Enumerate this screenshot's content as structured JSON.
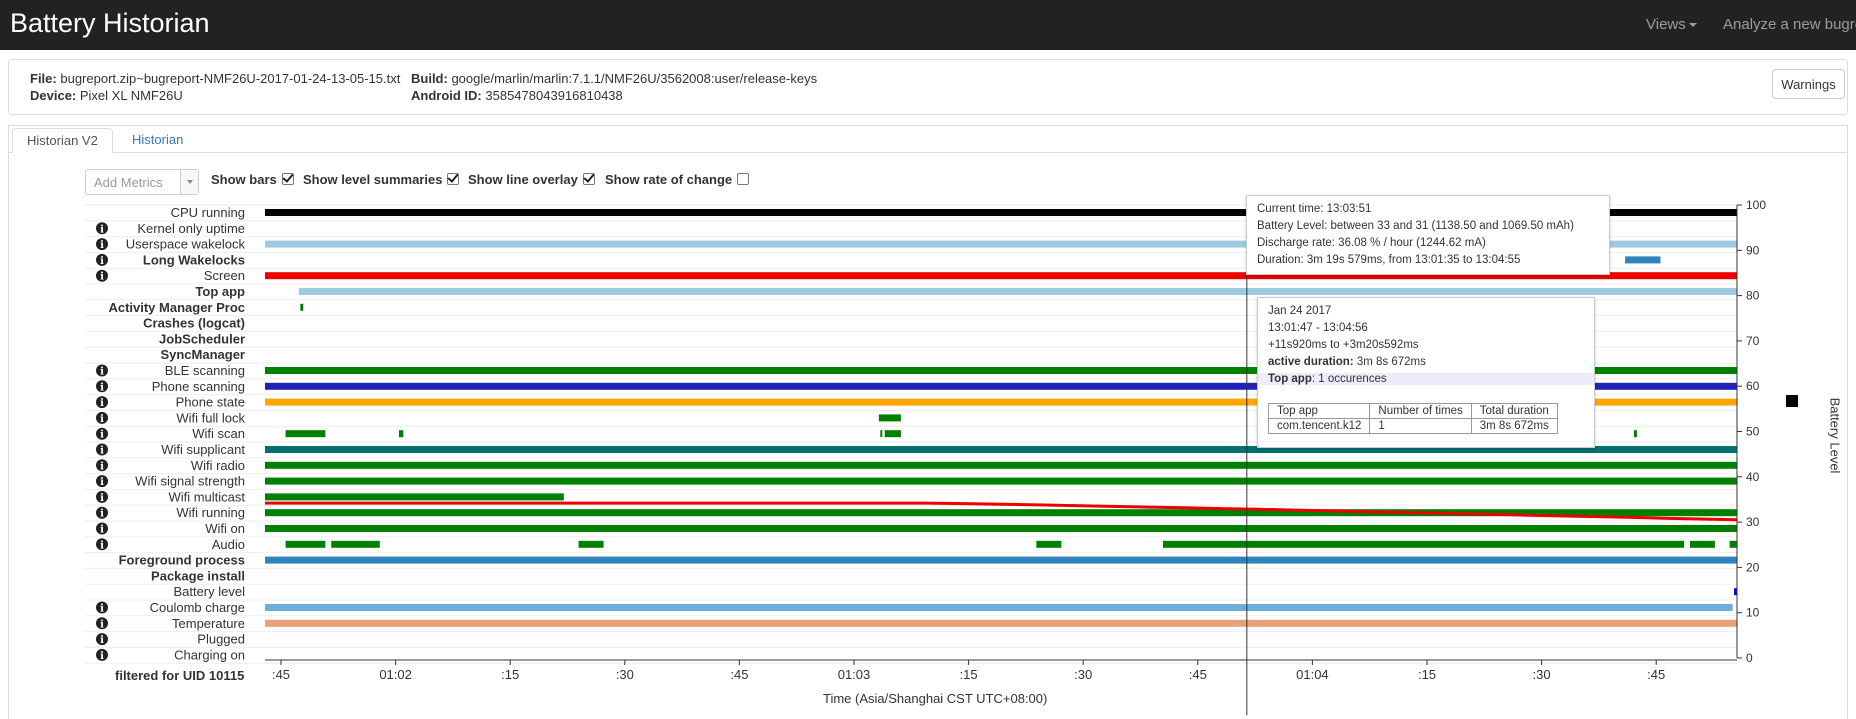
{
  "app": {
    "title": "Battery Historian",
    "nav": {
      "views": "Views",
      "analyze": "Analyze a new bugre"
    }
  },
  "file_info": {
    "file_label": "File:",
    "file_value": "bugreport.zip~bugreport-NMF26U-2017-01-24-13-05-15.txt",
    "device_label": "Device:",
    "device_value": "Pixel XL NMF26U",
    "build_label": "Build:",
    "build_value": "google/marlin/marlin:7.1.1/NMF26U/3562008:user/release-keys",
    "android_id_label": "Android ID:",
    "android_id_value": "3585478043916810438",
    "warnings_button": "Warnings"
  },
  "tabs": [
    {
      "label": "Historian V2",
      "active": true
    },
    {
      "label": "Historian",
      "active": false
    }
  ],
  "controls": {
    "add_metrics_placeholder": "Add Metrics",
    "show_bars": {
      "label": "Show bars",
      "checked": true
    },
    "show_level_summaries": {
      "label": "Show level summaries",
      "checked": true
    },
    "show_line_overlay": {
      "label": "Show line overlay",
      "checked": true
    },
    "show_rate_of_change": {
      "label": "Show rate of change",
      "checked": false
    }
  },
  "chart_data": {
    "type": "timeline",
    "x_label": "Time (Asia/Shanghai CST UTC+08:00)",
    "x_ticks": [
      ":45",
      "01:02",
      ":15",
      ":30",
      ":45",
      "01:03",
      ":15",
      ":30",
      ":45",
      "01:04",
      ":15",
      ":30",
      ":45"
    ],
    "y_right": {
      "label": "Battery Level",
      "ticks": [
        0,
        10,
        20,
        30,
        40,
        50,
        60,
        70,
        80,
        90,
        100
      ],
      "ylim": [
        0,
        100
      ]
    },
    "filter_label": "filtered for UID 10115",
    "battery_level_line": {
      "color": "#ee0000",
      "start": 34.2,
      "end": 30.5
    },
    "cursor_fraction": 0.667,
    "rows": [
      {
        "name": "CPU running",
        "bold": false,
        "info": false,
        "color": "#000000",
        "bars": [
          [
            0,
            1
          ]
        ]
      },
      {
        "name": "Kernel only uptime",
        "bold": false,
        "info": true,
        "color": "#000000",
        "bars": []
      },
      {
        "name": "Userspace wakelock",
        "bold": false,
        "info": true,
        "color": "#9ecae1",
        "bars": [
          [
            0,
            1
          ]
        ]
      },
      {
        "name": "Long Wakelocks",
        "bold": true,
        "info": true,
        "color": "#3182bd",
        "bars": [
          [
            0.924,
            0.948
          ]
        ]
      },
      {
        "name": "Screen",
        "bold": false,
        "info": true,
        "color": "#ee0000",
        "bars": [
          [
            0,
            1
          ]
        ]
      },
      {
        "name": "Top app",
        "bold": true,
        "info": false,
        "color": "#9ecae1",
        "bars": [
          [
            0.023,
            1
          ]
        ]
      },
      {
        "name": "Activity Manager Proc",
        "bold": true,
        "info": false,
        "color": "#008000",
        "bars": [
          [
            0.024,
            0.026
          ]
        ]
      },
      {
        "name": "Crashes (logcat)",
        "bold": true,
        "info": false,
        "color": "#000000",
        "bars": []
      },
      {
        "name": "JobScheduler",
        "bold": true,
        "info": false,
        "color": "#000000",
        "bars": []
      },
      {
        "name": "SyncManager",
        "bold": true,
        "info": false,
        "color": "#000000",
        "bars": []
      },
      {
        "name": "BLE scanning",
        "bold": false,
        "info": true,
        "color": "#008000",
        "bars": [
          [
            0,
            1
          ]
        ]
      },
      {
        "name": "Phone scanning",
        "bold": false,
        "info": true,
        "color": "#2222bb",
        "bars": [
          [
            0,
            1
          ]
        ]
      },
      {
        "name": "Phone state",
        "bold": false,
        "info": true,
        "color": "#ffa500",
        "bars": [
          [
            0,
            1
          ]
        ]
      },
      {
        "name": "Wifi full lock",
        "bold": false,
        "info": true,
        "color": "#008000",
        "bars": [
          [
            0.417,
            0.432
          ]
        ]
      },
      {
        "name": "Wifi scan",
        "bold": false,
        "info": true,
        "color": "#008000",
        "bars": [
          [
            0.014,
            0.041
          ],
          [
            0.091,
            0.094
          ],
          [
            0.418,
            0.419
          ],
          [
            0.421,
            0.432
          ],
          [
            0.93,
            0.932
          ]
        ]
      },
      {
        "name": "Wifi supplicant",
        "bold": false,
        "info": true,
        "color": "#007070",
        "bars": [
          [
            0,
            1
          ]
        ]
      },
      {
        "name": "Wifi radio",
        "bold": false,
        "info": true,
        "color": "#008000",
        "bars": [
          [
            0,
            1
          ]
        ]
      },
      {
        "name": "Wifi signal strength",
        "bold": false,
        "info": true,
        "color": "#008000",
        "bars": [
          [
            0,
            1
          ]
        ]
      },
      {
        "name": "Wifi multicast",
        "bold": false,
        "info": true,
        "color": "#008000",
        "bars": [
          [
            0,
            0.203
          ]
        ]
      },
      {
        "name": "Wifi running",
        "bold": false,
        "info": true,
        "color": "#008000",
        "bars": [
          [
            0,
            1
          ]
        ]
      },
      {
        "name": "Wifi on",
        "bold": false,
        "info": true,
        "color": "#008000",
        "bars": [
          [
            0,
            1
          ]
        ]
      },
      {
        "name": "Audio",
        "bold": false,
        "info": true,
        "color": "#008000",
        "bars": [
          [
            0.014,
            0.041
          ],
          [
            0.045,
            0.078
          ],
          [
            0.213,
            0.23
          ],
          [
            0.524,
            0.541
          ],
          [
            0.61,
            0.964
          ],
          [
            0.968,
            0.985
          ],
          [
            0.995,
            1
          ]
        ]
      },
      {
        "name": "Foreground process",
        "bold": true,
        "info": false,
        "color": "#3182bd",
        "bars": [
          [
            0,
            1
          ]
        ]
      },
      {
        "name": "Package install",
        "bold": true,
        "info": false,
        "color": "#000000",
        "bars": []
      },
      {
        "name": "Battery level",
        "bold": false,
        "info": false,
        "color": "#0000ee",
        "bars": [
          [
            0.998,
            1
          ]
        ]
      },
      {
        "name": "Coulomb charge",
        "bold": false,
        "info": true,
        "color": "#6baed6",
        "bars": [
          [
            0,
            0.997
          ]
        ]
      },
      {
        "name": "Temperature",
        "bold": false,
        "info": true,
        "color": "#e6a07a",
        "bars": [
          [
            0,
            1
          ]
        ]
      },
      {
        "name": "Plugged",
        "bold": false,
        "info": true,
        "color": "#000000",
        "bars": []
      },
      {
        "name": "Charging on",
        "bold": false,
        "info": true,
        "color": "#000000",
        "bars": []
      }
    ]
  },
  "tooltip_level": {
    "current_time": "Current time: 13:03:51",
    "battery_level": "Battery Level: between 33 and 31 (1138.50 and 1069.50 mAh)",
    "discharge_rate": "Discharge rate: 36.08 % / hour (1244.62 mA)",
    "duration": "Duration: 3m 19s 579ms, from 13:01:35 to 13:04:55"
  },
  "tooltip_app": {
    "date": "Jan 24 2017",
    "time_range": "13:01:47 - 13:04:56",
    "offset": "+11s920ms to +3m20s592ms",
    "active_duration_label": "active duration:",
    "active_duration_value": "3m 8s 672ms",
    "top_app_label": "Top app",
    "top_app_value": ": 1 occurences",
    "table_headers": [
      "Top app",
      "Number of times",
      "Total duration"
    ],
    "table_rows": [
      [
        "com.tencent.k12",
        "1",
        "3m 8s 672ms"
      ]
    ]
  }
}
